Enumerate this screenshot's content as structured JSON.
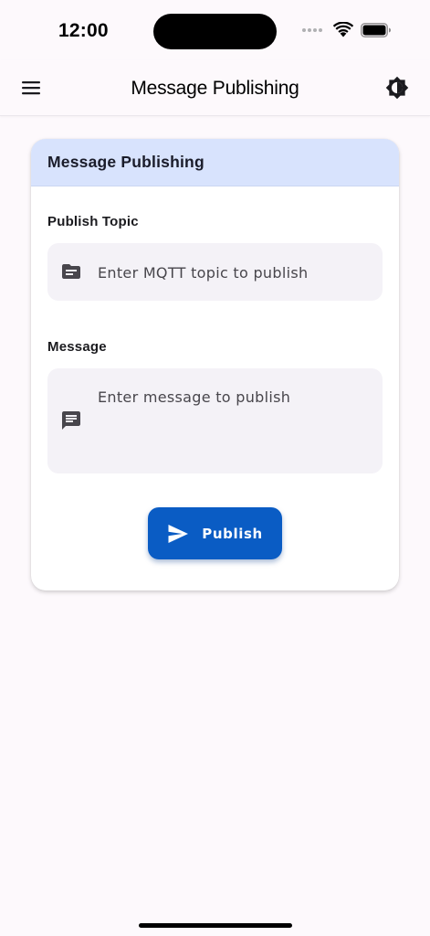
{
  "status_bar": {
    "time": "12:00"
  },
  "app_bar": {
    "title": "Message Publishing",
    "menu_icon": "hamburger-menu-icon",
    "theme_icon": "brightness-icon"
  },
  "card": {
    "header_title": "Message Publishing",
    "topic": {
      "label": "Publish Topic",
      "value": "",
      "placeholder": "Enter MQTT topic to publish",
      "icon": "topic-icon"
    },
    "message": {
      "label": "Message",
      "value": "",
      "placeholder": "Enter message to publish",
      "icon": "message-icon"
    },
    "publish_button": {
      "label": "Publish",
      "icon": "send-icon"
    }
  },
  "colors": {
    "background": "#fdf9fc",
    "card_header": "#d8e3fd",
    "input_fill": "#f4f2f7",
    "primary": "#0a5cc4"
  }
}
